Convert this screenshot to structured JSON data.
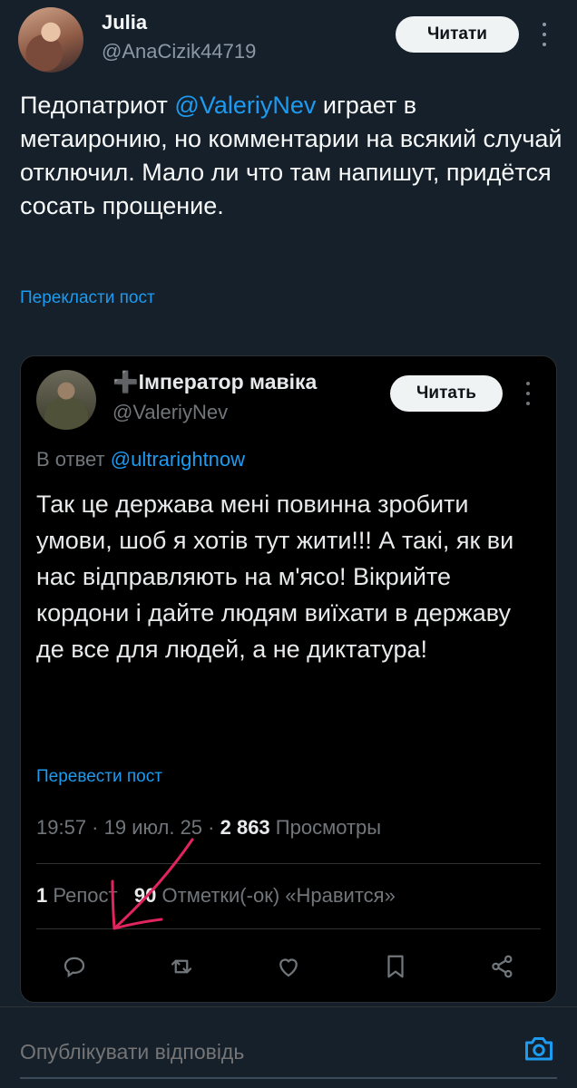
{
  "post": {
    "author_name": "Julia",
    "author_handle": "@AnaCizik44719",
    "follow_label": "Читати",
    "text_before": "Педопатриот ",
    "mention": "@ValeriyNev",
    "text_after": " играет в метаиронию, но комментарии на всякий случай отключил. Мало ли что там напишут, придётся сосать прощение.",
    "translate_label": "Перекласти пост"
  },
  "quote": {
    "author_name": "➕Імператор мавіка",
    "author_handle": "@ValeriyNev",
    "follow_label": "Читать",
    "reply_prefix": "В ответ ",
    "reply_mention": "@ultrarightnow",
    "text": "Так це держава мені повинна зробити умови, шоб я хотів тут жити!!! А такі, як ви нас відправляють на м'ясо! Вікрийте кордони і дайте людям виїхати в державу де все для людей, а не диктатура!",
    "translate_label": "Перевести пост",
    "time": "19:57",
    "date": "19 июл. 25",
    "views_count": "2 863",
    "views_label": "Просмотры",
    "reposts_count": "1",
    "reposts_label": "Репост",
    "likes_count": "90",
    "likes_label": "Отметки(-ок) «Нравится»"
  },
  "composer": {
    "placeholder": "Опублікувати відповідь"
  },
  "colors": {
    "background": "#15202b",
    "card_background": "#000000",
    "accent": "#1d9bf0",
    "annotation_arrow": "#e0245e"
  },
  "icons": [
    "more-icon",
    "reply-icon",
    "repost-icon",
    "like-icon",
    "bookmark-icon",
    "share-icon",
    "camera-icon"
  ]
}
